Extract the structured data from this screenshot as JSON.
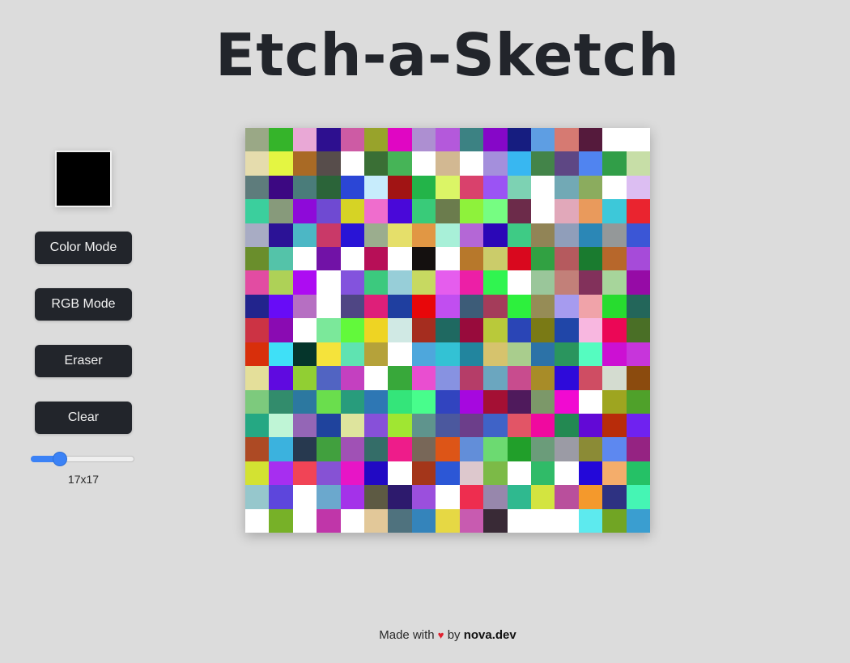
{
  "title": "Etch-a-Sketch",
  "controls": {
    "current_color": "#000000",
    "color_mode_label": "Color Mode",
    "rgb_mode_label": "RGB Mode",
    "eraser_label": "Eraser",
    "clear_label": "Clear",
    "grid_size": 17,
    "grid_size_min": 1,
    "grid_size_max": 64,
    "grid_size_label": "17x17",
    "accent_color": "#3b82f6"
  },
  "board": {
    "rows": 17,
    "cols": 17,
    "cells": [
      [
        "#9aa886",
        "#35b42a",
        "#e9a8d6",
        "#2d0f8f",
        "#cd5ba4",
        "#98a32b",
        "#e006c3",
        "#ad8fd1",
        "#b459db",
        "#3c8283",
        "#8607c8",
        "#161d80",
        "#5e9ee3",
        "#d67a72",
        "#551a3c",
        "#ffffff",
        "#ffffff"
      ],
      [
        "#e5dcad",
        "#e4f542",
        "#a96a25",
        "#574d4b",
        "#ffffff",
        "#3a6f35",
        "#46b457",
        "#ffffff",
        "#d2b892",
        "#ffffff",
        "#a48fdc",
        "#38b7f1",
        "#438449",
        "#5e4784",
        "#5084f0",
        "#319e48",
        "#c7dea7"
      ],
      [
        "#5e7c7c",
        "#3c0882",
        "#4a7c7a",
        "#2b6439",
        "#2b46d6",
        "#c7ecfc",
        "#a11414",
        "#23b449",
        "#dbf566",
        "#d9416c",
        "#9b53f4",
        "#7dd2b3",
        "#ffffff",
        "#72a9b5",
        "#8bac5e",
        "#ffffff",
        "#dcbef2"
      ],
      [
        "#3bcf9d",
        "#879a7b",
        "#8e0ad9",
        "#6f4ad2",
        "#d6d325",
        "#ef6dcd",
        "#4908d9",
        "#39cb79",
        "#6b7c4d",
        "#8ef23b",
        "#76fd82",
        "#6c2b4a",
        "#ffffff",
        "#e1a8ba",
        "#e99a5c",
        "#3dc8d9",
        "#ea242f"
      ],
      [
        "#a8acc4",
        "#2b1296",
        "#4cb7c5",
        "#c93968",
        "#2914d6",
        "#9bad8e",
        "#e5df6a",
        "#e19744",
        "#a8f0d8",
        "#b467d6",
        "#2b07b7",
        "#3ecb85",
        "#918456",
        "#909eba",
        "#2b87b6",
        "#949899",
        "#3b56d6"
      ],
      [
        "#6a8e2c",
        "#54c3a9",
        "#ffffff",
        "#7112a6",
        "#ffffff",
        "#b70f57",
        "#ffffff",
        "#14100f",
        "#ffffff",
        "#b7782b",
        "#cbcc6a",
        "#d9081e",
        "#31a142",
        "#b55a5e",
        "#1a7b2f",
        "#b7672b",
        "#a64bd9"
      ],
      [
        "#e24ca2",
        "#aed157",
        "#ad0cf2",
        "#ffffff",
        "#8353dd",
        "#3cc97e",
        "#97ced8",
        "#c7d961",
        "#e55ded",
        "#ec1fa6",
        "#30f450",
        "#ffffff",
        "#9ac69a",
        "#c28079",
        "#82315b",
        "#a7d59b",
        "#960ba6"
      ],
      [
        "#22248d",
        "#680cf7",
        "#b66fc2",
        "#ffffff",
        "#4f4684",
        "#de1f79",
        "#1f3fa0",
        "#e8070a",
        "#c14ef0",
        "#3d5c78",
        "#a43c5a",
        "#2df03d",
        "#968c56",
        "#a69bef",
        "#f0a3a9",
        "#27dc2f",
        "#23665a"
      ],
      [
        "#cc3344",
        "#8a0bb2",
        "#ffffff",
        "#7be89a",
        "#62f93b",
        "#eed423",
        "#d0e9e4",
        "#a52d1f",
        "#1f6961",
        "#980b3c",
        "#b9c93a",
        "#2a45b6",
        "#7a7a15",
        "#2046a8",
        "#f8b7e0",
        "#eb0756",
        "#4a6f26"
      ],
      [
        "#d82f0b",
        "#3fe0f7",
        "#05352b",
        "#f5e33b",
        "#5fe3b1",
        "#b5a23a",
        "#ffffff",
        "#4ea7dc",
        "#33c2d4",
        "#22859e",
        "#d6c36d",
        "#a9cd8d",
        "#2c72a7",
        "#2a955e",
        "#55fcc0",
        "#cc10d3",
        "#c735db"
      ],
      [
        "#e4df9a",
        "#5f0ae0",
        "#91cf33",
        "#5164c2",
        "#c440c0",
        "#ffffff",
        "#38a83a",
        "#e94ed0",
        "#8792e1",
        "#b53d68",
        "#6ba6bf",
        "#c84c8e",
        "#a88c28",
        "#2e0ada",
        "#cf4d63",
        "#d4dcd0",
        "#8b4b0e"
      ],
      [
        "#7dca7d",
        "#328c6c",
        "#2c78a0",
        "#6ade4d",
        "#289c7c",
        "#2e77b4",
        "#34e57a",
        "#48fd8c",
        "#3144bf",
        "#a608df",
        "#a41034",
        "#4f1a5c",
        "#7c9869",
        "#f10ad1",
        "#ffffff",
        "#9ea520",
        "#4fa12a"
      ],
      [
        "#25a883",
        "#bff5d6",
        "#9466b6",
        "#1f439d",
        "#dee49d",
        "#8750d9",
        "#a0e632",
        "#5f948d",
        "#4b589e",
        "#6c3e8a",
        "#3f63c7",
        "#e25566",
        "#f0099f",
        "#238952",
        "#6209d6",
        "#b82c0a",
        "#6f22f0"
      ],
      [
        "#ad4a24",
        "#3bb2de",
        "#27394f",
        "#41a03e",
        "#a051b5",
        "#346d68",
        "#ee1c8a",
        "#786758",
        "#dd5517",
        "#628ed9",
        "#6cda71",
        "#219f2a",
        "#6b9c7a",
        "#9b9ba5",
        "#8b8b36",
        "#5d88f0",
        "#952382"
      ],
      [
        "#d3e232",
        "#a72ef0",
        "#f14456",
        "#8652d4",
        "#e715c6",
        "#2109c4",
        "#ffffff",
        "#a4361a",
        "#2c57d6",
        "#ddc8cd",
        "#7cba47",
        "#ffffff",
        "#30bb68",
        "#ffffff",
        "#2308d9",
        "#f4ad6b",
        "#25c166"
      ],
      [
        "#96c7cc",
        "#5d46dc",
        "#ffffff",
        "#6ba8cd",
        "#a432e9",
        "#5d5a43",
        "#2d1a6d",
        "#9b4fdd",
        "#ffffff",
        "#ee2d4f",
        "#9787ac",
        "#2fb98f",
        "#d3e440",
        "#b94f9c",
        "#f4992c",
        "#2e3282",
        "#45f5b4"
      ],
      [
        "#ffffff",
        "#77b128",
        "#ffffff",
        "#c036a9",
        "#ffffff",
        "#e2c899",
        "#4f727e",
        "#3484bb",
        "#e6d844",
        "#c85bb0",
        "#392a36",
        "#ffffff",
        "#ffffff",
        "#ffffff",
        "#5deaee",
        "#71a524",
        "#3a9ed0"
      ]
    ]
  },
  "footer": {
    "prefix": "Made with",
    "heart": "♥",
    "by": "by",
    "author": "nova.dev"
  }
}
